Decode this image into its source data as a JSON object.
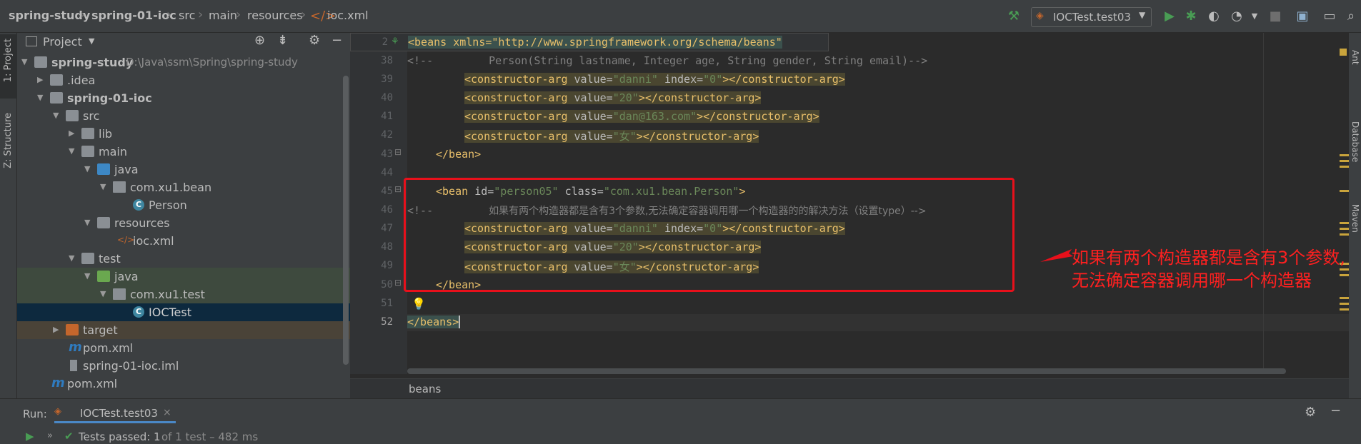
{
  "breadcrumbs": [
    "spring-study",
    "spring-01-ioc",
    "src",
    "main",
    "resources",
    "ioc.xml"
  ],
  "run_config": "IOCTest.test03",
  "left_strip": {
    "project": "1: Project",
    "structure": "Z: Structure"
  },
  "right_strip": {
    "ant": "Ant",
    "database": "Database",
    "maven": "Maven"
  },
  "project_panel": {
    "title": "Project",
    "tree": [
      {
        "label": "spring-study",
        "path": "D:\\Java\\ssm\\Spring\\spring-study",
        "icon": "folder-module-icon"
      },
      {
        "label": ".idea",
        "icon": "folder-icon"
      },
      {
        "label": "spring-01-ioc",
        "icon": "folder-module-icon"
      },
      {
        "label": "src",
        "icon": "folder-icon"
      },
      {
        "label": "lib",
        "icon": "folder-icon"
      },
      {
        "label": "main",
        "icon": "folder-icon"
      },
      {
        "label": "java",
        "icon": "folder-source-icon"
      },
      {
        "label": "com.xu1.bean",
        "icon": "package-icon"
      },
      {
        "label": "Person",
        "icon": "class-icon"
      },
      {
        "label": "resources",
        "icon": "folder-resources-icon"
      },
      {
        "label": "ioc.xml",
        "icon": "xml-file-icon"
      },
      {
        "label": "test",
        "icon": "folder-icon"
      },
      {
        "label": "java",
        "icon": "folder-test-icon"
      },
      {
        "label": "com.xu1.test",
        "icon": "package-icon"
      },
      {
        "label": "IOCTest",
        "icon": "test-class-icon"
      },
      {
        "label": "target",
        "icon": "folder-excluded-icon"
      },
      {
        "label": "pom.xml",
        "icon": "maven-icon"
      },
      {
        "label": "spring-01-ioc.iml",
        "icon": "iml-file-icon"
      },
      {
        "label": "pom.xml",
        "icon": "maven-icon"
      }
    ]
  },
  "editor": {
    "sticky_line": "2",
    "sticky_code": "<beans xmlns=\"http://www.springframework.org/schema/beans\"",
    "lines": [
      "38",
      "39",
      "40",
      "41",
      "42",
      "43",
      "44",
      "45",
      "46",
      "47",
      "48",
      "49",
      "50",
      "51",
      "52"
    ],
    "code": {
      "l38_comment_open": "<!--",
      "l38_text": "Person(String lastname, Integer age, String gender, String email)-->",
      "ca_open": "<constructor-arg",
      "ca_close": "></constructor-arg>",
      "value_attr": "value=",
      "index_attr": "index=",
      "v_danni": "\"danni\"",
      "v_0": "\"0\"",
      "v_20": "\"20\"",
      "v_email": "\"dan@163.com\"",
      "v_female": "\"女\"",
      "bean_close": "</bean>",
      "bean_open": "<bean",
      "id_attr": "id=",
      "v_person05": "\"person05\"",
      "class_attr": "class=",
      "v_class": "\"com.xu1.bean.Person\"",
      "gt": ">",
      "l46_comment_open": "<!--",
      "l46_text": "如果有两个构造器都是含有3个参数,无法确定容器调用哪一个构造器的的解决方法（设置type）-->",
      "beans_close": "</beans>"
    },
    "annotation_line1": "如果有两个构造器都是含有3个参数,",
    "annotation_line2": "无法确定容器调用哪一个构造器",
    "breadcrumb": "beans"
  },
  "run_panel": {
    "label": "Run:",
    "tab": "IOCTest.test03",
    "status_strong": "Tests passed: 1",
    "status_detail": "of 1 test – 482 ms"
  },
  "colors": {
    "annotation_red": "#e8101b",
    "run_green": "#499c54"
  }
}
